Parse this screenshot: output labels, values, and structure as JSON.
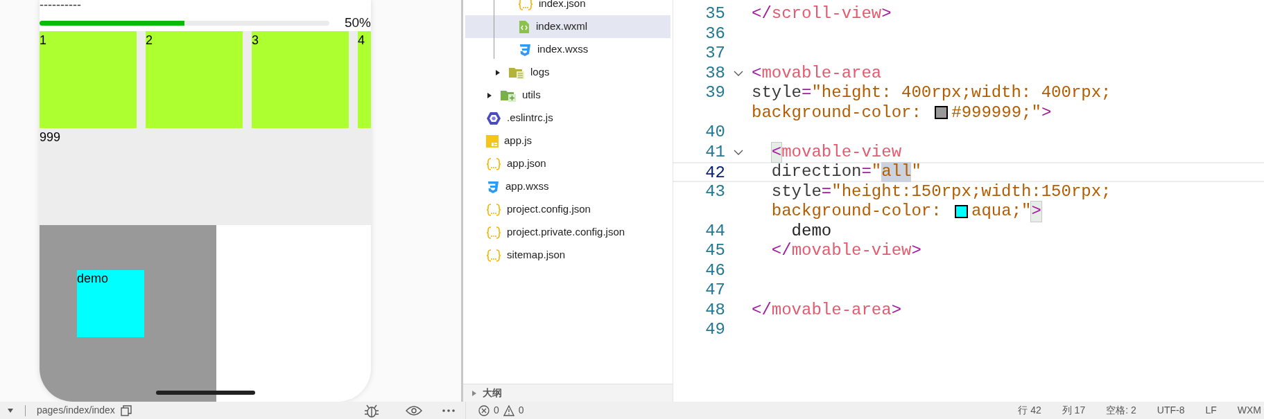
{
  "simulator": {
    "divider_text": "----------",
    "progress": {
      "level": 0.5,
      "reading": "50%"
    },
    "swiper_items": [
      "1",
      "2",
      "3",
      "4"
    ],
    "scroll_text": "999",
    "movable_area": {
      "color": "#999999",
      "view": {
        "text": "demo",
        "color": "#00ffff"
      }
    }
  },
  "simulator_toolbar": {
    "page_path": "pages/index/index"
  },
  "file_tree": {
    "index_files": [
      {
        "name": "index.json",
        "kind": "json",
        "selected": false
      },
      {
        "name": "index.wxml",
        "kind": "wxml",
        "selected": true
      },
      {
        "name": "index.wxss",
        "kind": "wxss",
        "selected": false
      }
    ],
    "pages_items": [
      {
        "name": "logs",
        "kind": "folder",
        "expanded": false,
        "selected": false
      }
    ],
    "root_items": [
      {
        "name": "utils",
        "kind": "folder-util",
        "expanded": false,
        "selected": false
      },
      {
        "name": ".eslintrc.js",
        "kind": "eslint",
        "selected": false
      },
      {
        "name": "app.js",
        "kind": "js",
        "selected": false
      },
      {
        "name": "app.json",
        "kind": "json",
        "selected": false
      },
      {
        "name": "app.wxss",
        "kind": "wxss",
        "selected": false
      },
      {
        "name": "project.config.json",
        "kind": "json",
        "selected": false
      },
      {
        "name": "project.private.config.json",
        "kind": "json",
        "selected": false
      },
      {
        "name": "sitemap.json",
        "kind": "json",
        "selected": false
      }
    ]
  },
  "outline_panel": {
    "title": "大纲",
    "expanded": false
  },
  "problems": {
    "errors": "0",
    "warnings": "0"
  },
  "editor": {
    "lines": [
      {
        "number": "35",
        "fold": false,
        "current": false,
        "tokens": [
          {
            "kind": "punct",
            "text": "</"
          },
          {
            "kind": "tag",
            "text": "scroll-view"
          },
          {
            "kind": "punct",
            "text": ">"
          }
        ]
      },
      {
        "number": "36",
        "fold": false,
        "current": false
      },
      {
        "number": "37",
        "fold": false,
        "current": false
      },
      {
        "number": "38",
        "fold": true,
        "current": false,
        "tokens": [
          {
            "kind": "punct",
            "text": "<"
          },
          {
            "kind": "tag",
            "text": "movable-area"
          }
        ]
      },
      {
        "number": "39",
        "fold": false,
        "current": false,
        "tokens": [
          {
            "kind": "attr",
            "text": "style"
          },
          {
            "kind": "punct",
            "text": "="
          },
          {
            "kind": "string",
            "text": "\"height: 400rpx;width: 400rpx;"
          }
        ],
        "wrap": [
          {
            "kind": "string",
            "text": "background-color: "
          },
          {
            "kind": "swatch",
            "color": "#999999"
          },
          {
            "kind": "string",
            "text": "#999999;\""
          },
          {
            "kind": "punct",
            "text": ">"
          }
        ]
      },
      {
        "number": "40",
        "fold": false,
        "current": false
      },
      {
        "number": "41",
        "fold": true,
        "current": false,
        "tokens": [
          {
            "kind": "bracket-match",
            "text": "  <"
          },
          {
            "kind": "tag",
            "text": "movable-view"
          }
        ]
      },
      {
        "number": "42",
        "fold": false,
        "current": true,
        "tokens": [
          {
            "kind": "attr",
            "text": "  direction"
          },
          {
            "kind": "punct",
            "text": "="
          },
          {
            "kind": "string",
            "text": "\""
          },
          {
            "kind": "selection",
            "text": "all"
          },
          {
            "kind": "string",
            "text": "\""
          }
        ]
      },
      {
        "number": "43",
        "fold": false,
        "current": false,
        "tokens": [
          {
            "kind": "attr",
            "text": "  style"
          },
          {
            "kind": "punct",
            "text": "="
          },
          {
            "kind": "string",
            "text": "\"height:150rpx;width:150rpx;"
          }
        ],
        "wrap": [
          {
            "kind": "string",
            "text": "  background-color: "
          },
          {
            "kind": "swatch",
            "color": "#00ffff"
          },
          {
            "kind": "string",
            "text": "aqua;\""
          },
          {
            "kind": "bracket-match",
            "text": ">"
          }
        ]
      },
      {
        "number": "44",
        "fold": false,
        "current": false,
        "tokens": [
          {
            "kind": "text",
            "text": "    demo"
          }
        ]
      },
      {
        "number": "45",
        "fold": false,
        "current": false,
        "tokens": [
          {
            "kind": "punct",
            "text": "  </"
          },
          {
            "kind": "tag",
            "text": "movable-view"
          },
          {
            "kind": "punct",
            "text": ">"
          }
        ]
      },
      {
        "number": "46",
        "fold": false,
        "current": false
      },
      {
        "number": "47",
        "fold": false,
        "current": false
      },
      {
        "number": "48",
        "fold": false,
        "current": false,
        "tokens": [
          {
            "kind": "punct",
            "text": "</"
          },
          {
            "kind": "tag",
            "text": "movable-area"
          },
          {
            "kind": "punct",
            "text": ">"
          }
        ]
      },
      {
        "number": "49",
        "fold": false,
        "current": false
      }
    ]
  },
  "status_bar": [
    "行 42",
    "列 17",
    "空格: 2",
    "UTF-8",
    "LF",
    "WXM"
  ]
}
